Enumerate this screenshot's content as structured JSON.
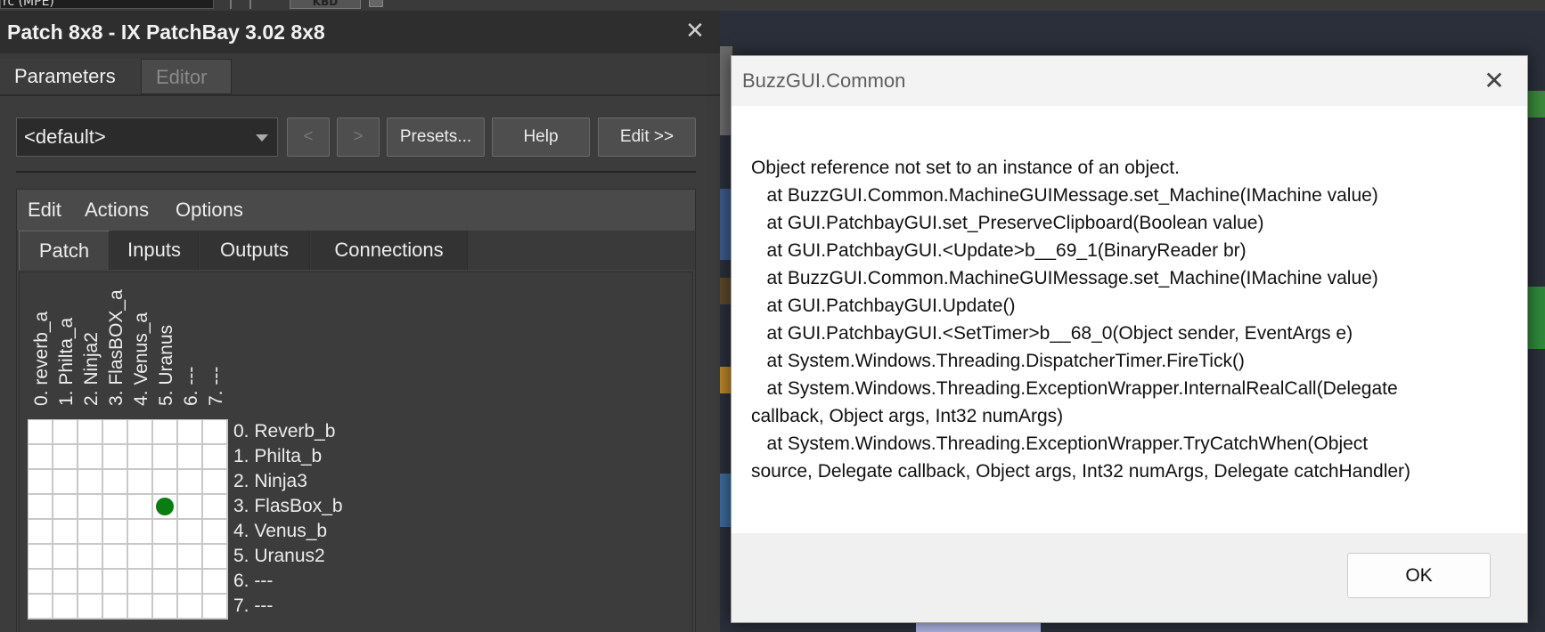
{
  "background": {
    "top_combo_text": "rc (MPE)",
    "kbd_label": "KBD"
  },
  "patch_window": {
    "title": "Patch 8x8 - IX PatchBay 3.02 8x8",
    "close_glyph": "✕",
    "tabs": [
      {
        "label": "Parameters",
        "active": true
      },
      {
        "label": "Editor",
        "active": false
      }
    ],
    "preset": {
      "value": "<default>"
    },
    "buttons": {
      "prev": "<",
      "next": ">",
      "presets": "Presets...",
      "help": "Help",
      "edit": "Edit >>"
    },
    "menu": [
      "Edit",
      "Actions",
      "Options"
    ],
    "sub_tabs": [
      "Patch",
      "Inputs",
      "Outputs",
      "Connections"
    ],
    "active_sub_tab": "Patch",
    "columns": [
      "0. reverb_a",
      "1. Philta_a",
      "2. Ninja2",
      "3. FlasBOX_a",
      "4. Venus_a",
      "5. Uranus",
      "6. ---",
      "7. ---"
    ],
    "rows": [
      "0. Reverb_b",
      "1. Philta_b",
      "2. Ninja3",
      "3. FlasBox_b",
      "4. Venus_b",
      "5. Uranus2",
      "6. ---",
      "7. ---"
    ],
    "connections": [
      {
        "row": 3,
        "col": 5
      }
    ],
    "connection_color": "#0a7d12"
  },
  "dialog": {
    "title": "BuzzGUI.Common",
    "close_glyph": "✕",
    "message_lines": [
      "Object reference not set to an instance of an object.",
      "   at BuzzGUI.Common.MachineGUIMessage.set_Machine(IMachine value)",
      "   at GUI.PatchbayGUI.set_PreserveClipboard(Boolean value)",
      "   at GUI.PatchbayGUI.<Update>b__69_1(BinaryReader br)",
      "   at BuzzGUI.Common.MachineGUIMessage.set_Machine(IMachine value)",
      "   at GUI.PatchbayGUI.Update()",
      "   at GUI.PatchbayGUI.<SetTimer>b__68_0(Object sender, EventArgs e)",
      "   at System.Windows.Threading.DispatcherTimer.FireTick()",
      "   at System.Windows.Threading.ExceptionWrapper.InternalRealCall(Delegate",
      "callback, Object args, Int32 numArgs)",
      "   at System.Windows.Threading.ExceptionWrapper.TryCatchWhen(Object",
      "source, Delegate callback, Object args, Int32 numArgs, Delegate catchHandler)"
    ],
    "ok_label": "OK"
  }
}
